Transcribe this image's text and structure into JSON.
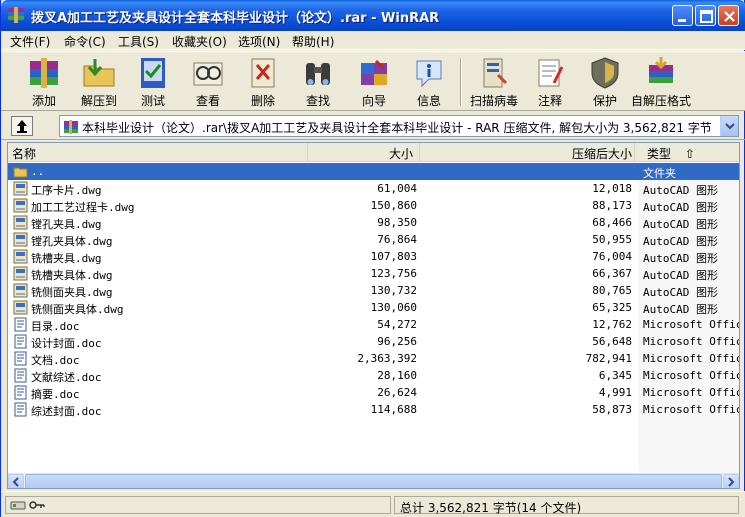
{
  "window": {
    "title": "拨叉A加工工艺及夹具设计全套本科毕业设计（论文）.rar - WinRAR"
  },
  "menu": [
    {
      "label": "文件(F)"
    },
    {
      "label": "命令(C)"
    },
    {
      "label": "工具(S)"
    },
    {
      "label": "收藏夹(O)"
    },
    {
      "label": "选项(N)"
    },
    {
      "label": "帮助(H)"
    }
  ],
  "toolbar": [
    {
      "label": "添加",
      "icon": "books-icon"
    },
    {
      "label": "解压到",
      "icon": "folder-extract-icon"
    },
    {
      "label": "测试",
      "icon": "test-icon"
    },
    {
      "label": "查看",
      "icon": "view-icon"
    },
    {
      "label": "删除",
      "icon": "delete-icon"
    },
    {
      "label": "查找",
      "icon": "binoculars-icon"
    },
    {
      "label": "向导",
      "icon": "wizard-icon"
    },
    {
      "label": "信息",
      "icon": "info-icon"
    },
    {
      "label": "扫描病毒",
      "icon": "scan-virus-icon"
    },
    {
      "label": "注释",
      "icon": "comment-icon"
    },
    {
      "label": "保护",
      "icon": "shield-icon"
    },
    {
      "label": "自解压格式",
      "icon": "sfx-icon"
    }
  ],
  "address": {
    "path": "本科毕业设计（论文）.rar\\拨叉A加工工艺及夹具设计全套本科毕业设计 - RAR 压缩文件, 解包大小为 3,562,821 字节"
  },
  "columns": {
    "name": "名称",
    "size": "大小",
    "packed": "压缩后大小",
    "type": "类型",
    "sort_arrow": "⇧"
  },
  "files": [
    {
      "name": "..",
      "size": "",
      "packed": "",
      "type": "文件夹",
      "kind": "up"
    },
    {
      "name": "工序卡片.dwg",
      "size": "61,004",
      "packed": "12,018",
      "type": "AutoCAD 图形",
      "kind": "dwg"
    },
    {
      "name": "加工工艺过程卡.dwg",
      "size": "150,860",
      "packed": "88,173",
      "type": "AutoCAD 图形",
      "kind": "dwg"
    },
    {
      "name": "镗孔夹具.dwg",
      "size": "98,350",
      "packed": "68,466",
      "type": "AutoCAD 图形",
      "kind": "dwg"
    },
    {
      "name": "镗孔夹具体.dwg",
      "size": "76,864",
      "packed": "50,955",
      "type": "AutoCAD 图形",
      "kind": "dwg"
    },
    {
      "name": "铣槽夹具.dwg",
      "size": "107,803",
      "packed": "76,004",
      "type": "AutoCAD 图形",
      "kind": "dwg"
    },
    {
      "name": "铣槽夹具体.dwg",
      "size": "123,756",
      "packed": "66,367",
      "type": "AutoCAD 图形",
      "kind": "dwg"
    },
    {
      "name": "铣侧面夹具.dwg",
      "size": "130,732",
      "packed": "80,765",
      "type": "AutoCAD 图形",
      "kind": "dwg"
    },
    {
      "name": "铣侧面夹具体.dwg",
      "size": "130,060",
      "packed": "65,325",
      "type": "AutoCAD 图形",
      "kind": "dwg"
    },
    {
      "name": "目录.doc",
      "size": "54,272",
      "packed": "12,762",
      "type": "Microsoft Offic...",
      "kind": "doc"
    },
    {
      "name": "设计封面.doc",
      "size": "96,256",
      "packed": "56,648",
      "type": "Microsoft Offic...",
      "kind": "doc"
    },
    {
      "name": "文档.doc",
      "size": "2,363,392",
      "packed": "782,941",
      "type": "Microsoft Offic...",
      "kind": "doc"
    },
    {
      "name": "文献综述.doc",
      "size": "28,160",
      "packed": "6,345",
      "type": "Microsoft Offic...",
      "kind": "doc"
    },
    {
      "name": "摘要.doc",
      "size": "26,624",
      "packed": "4,991",
      "type": "Microsoft Offic...",
      "kind": "doc"
    },
    {
      "name": "综述封面.doc",
      "size": "114,688",
      "packed": "58,873",
      "type": "Microsoft Offic...",
      "kind": "doc"
    }
  ],
  "status": {
    "right": "总计 3,562,821 字节(14 个文件)"
  }
}
